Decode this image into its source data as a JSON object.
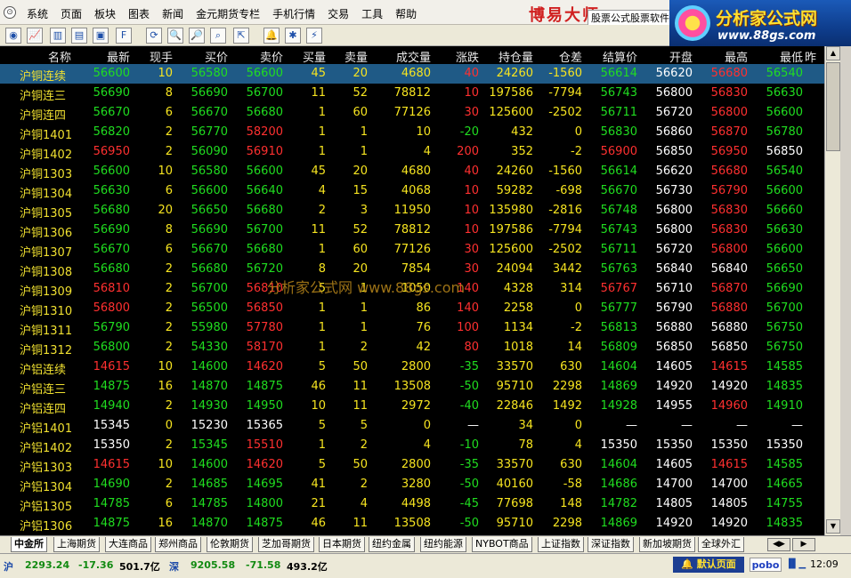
{
  "menubar": {
    "items": [
      "系统",
      "页面",
      "板块",
      "图表",
      "新闻",
      "金元期货专栏",
      "手机行情",
      "交易",
      "工具",
      "帮助"
    ],
    "brand_title": "博易大师",
    "soft_label": "股票公式股票软件"
  },
  "logo": {
    "name": "分析家公式网",
    "url": "www.88gs.com"
  },
  "toolbar": {
    "buttons": [
      {
        "icon": "circle-menu-icon",
        "glyph": "◉"
      },
      {
        "icon": "line-chart-icon",
        "glyph": "📈"
      },
      {
        "icon": "bar-chart-icon",
        "glyph": "▥"
      },
      {
        "icon": "table-icon",
        "glyph": "▤"
      },
      {
        "icon": "window-icon",
        "glyph": "▣"
      },
      {
        "icon": "f10-icon",
        "glyph": "F"
      },
      {
        "icon": "refresh-icon",
        "glyph": "⟳"
      },
      {
        "icon": "zoom-in-icon",
        "glyph": "🔍"
      },
      {
        "icon": "zoom-out-icon",
        "glyph": "🔎"
      },
      {
        "icon": "chart-search-icon",
        "glyph": "⌕"
      },
      {
        "icon": "export-icon",
        "glyph": "⇱"
      },
      {
        "icon": "alarm-icon",
        "glyph": "🔔"
      },
      {
        "icon": "settings-icon",
        "glyph": "✱"
      },
      {
        "icon": "lightning-icon",
        "glyph": "⚡"
      }
    ]
  },
  "grid": {
    "headers": [
      "名称",
      "最新",
      "现手",
      "买价",
      "卖价",
      "买量",
      "卖量",
      "成交量",
      "涨跌",
      "持仓量",
      "仓差",
      "结算价",
      "开盘",
      "最高",
      "最低",
      "昨"
    ],
    "watermark": "分析家公式网 www.88gs.com",
    "rows": [
      [
        "沪铜连续",
        "56600",
        "10",
        "56580",
        "56600",
        "45",
        "20",
        "4680",
        "40",
        "24260",
        "-1560",
        "56614",
        "56620",
        "56680",
        "56540"
      ],
      [
        "沪铜连三",
        "56690",
        "8",
        "56690",
        "56700",
        "11",
        "52",
        "78812",
        "10",
        "197586",
        "-7794",
        "56743",
        "56800",
        "56830",
        "56630"
      ],
      [
        "沪铜连四",
        "56670",
        "6",
        "56670",
        "56680",
        "1",
        "60",
        "77126",
        "30",
        "125600",
        "-2502",
        "56711",
        "56720",
        "56800",
        "56600"
      ],
      [
        "沪铜1401",
        "56820",
        "2",
        "56770",
        "58200",
        "1",
        "1",
        "10",
        "-20",
        "432",
        "0",
        "56830",
        "56860",
        "56870",
        "56780"
      ],
      [
        "沪铜1402",
        "56950",
        "2",
        "56090",
        "56910",
        "1",
        "1",
        "4",
        "200",
        "352",
        "-2",
        "56900",
        "56850",
        "56950",
        "56850"
      ],
      [
        "沪铜1303",
        "56600",
        "10",
        "56580",
        "56600",
        "45",
        "20",
        "4680",
        "40",
        "24260",
        "-1560",
        "56614",
        "56620",
        "56680",
        "56540"
      ],
      [
        "沪铜1304",
        "56630",
        "6",
        "56600",
        "56640",
        "4",
        "15",
        "4068",
        "10",
        "59282",
        "-698",
        "56670",
        "56730",
        "56790",
        "56600"
      ],
      [
        "沪铜1305",
        "56680",
        "20",
        "56650",
        "56680",
        "2",
        "3",
        "11950",
        "10",
        "135980",
        "-2816",
        "56748",
        "56800",
        "56830",
        "56660"
      ],
      [
        "沪铜1306",
        "56690",
        "8",
        "56690",
        "56700",
        "11",
        "52",
        "78812",
        "10",
        "197586",
        "-7794",
        "56743",
        "56800",
        "56830",
        "56630"
      ],
      [
        "沪铜1307",
        "56670",
        "6",
        "56670",
        "56680",
        "1",
        "60",
        "77126",
        "30",
        "125600",
        "-2502",
        "56711",
        "56720",
        "56800",
        "56600"
      ],
      [
        "沪铜1308",
        "56680",
        "2",
        "56680",
        "56720",
        "8",
        "20",
        "7854",
        "30",
        "24094",
        "3442",
        "56763",
        "56840",
        "56840",
        "56650"
      ],
      [
        "沪铜1309",
        "56810",
        "2",
        "56700",
        "56810",
        "5",
        "1",
        "1050",
        "140",
        "4328",
        "314",
        "56767",
        "56710",
        "56870",
        "56690"
      ],
      [
        "沪铜1310",
        "56800",
        "2",
        "56500",
        "56850",
        "1",
        "1",
        "86",
        "140",
        "2258",
        "0",
        "56777",
        "56790",
        "56880",
        "56700"
      ],
      [
        "沪铜1311",
        "56790",
        "2",
        "55980",
        "57780",
        "1",
        "1",
        "76",
        "100",
        "1134",
        "-2",
        "56813",
        "56880",
        "56880",
        "56750"
      ],
      [
        "沪铜1312",
        "56800",
        "2",
        "54330",
        "58170",
        "1",
        "2",
        "42",
        "80",
        "1018",
        "14",
        "56809",
        "56850",
        "56850",
        "56750"
      ],
      [
        "沪铝连续",
        "14615",
        "10",
        "14600",
        "14620",
        "5",
        "50",
        "2800",
        "-35",
        "33570",
        "630",
        "14604",
        "14605",
        "14615",
        "14585"
      ],
      [
        "沪铝连三",
        "14875",
        "16",
        "14870",
        "14875",
        "46",
        "11",
        "13508",
        "-50",
        "95710",
        "2298",
        "14869",
        "14920",
        "14920",
        "14835"
      ],
      [
        "沪铝连四",
        "14940",
        "2",
        "14930",
        "14950",
        "10",
        "11",
        "2972",
        "-40",
        "22846",
        "1492",
        "14928",
        "14955",
        "14960",
        "14910"
      ],
      [
        "沪铝1401",
        "15345",
        "0",
        "15230",
        "15365",
        "5",
        "5",
        "0",
        "—",
        "34",
        "0",
        "—",
        "—",
        "—",
        "—"
      ],
      [
        "沪铝1402",
        "15350",
        "2",
        "15345",
        "15510",
        "1",
        "2",
        "4",
        "-10",
        "78",
        "4",
        "15350",
        "15350",
        "15350",
        "15350"
      ],
      [
        "沪铝1303",
        "14615",
        "10",
        "14600",
        "14620",
        "5",
        "50",
        "2800",
        "-35",
        "33570",
        "630",
        "14604",
        "14605",
        "14615",
        "14585"
      ],
      [
        "沪铝1304",
        "14690",
        "2",
        "14685",
        "14695",
        "41",
        "2",
        "3280",
        "-50",
        "40160",
        "-58",
        "14686",
        "14700",
        "14700",
        "14665"
      ],
      [
        "沪铝1305",
        "14785",
        "6",
        "14785",
        "14800",
        "21",
        "4",
        "4498",
        "-45",
        "77698",
        "148",
        "14782",
        "14805",
        "14805",
        "14755"
      ],
      [
        "沪铝1306",
        "14875",
        "16",
        "14870",
        "14875",
        "46",
        "11",
        "13508",
        "-50",
        "95710",
        "2298",
        "14869",
        "14920",
        "14920",
        "14835"
      ]
    ]
  },
  "tabs": [
    "中金所",
    "上海期货",
    "大连商品",
    "郑州商品",
    "伦敦期货",
    "芝加哥期货",
    "日本期货",
    "纽约金属",
    "纽约能源",
    "NYBOT商品",
    "上证指数",
    "深证指数",
    "新加坡期货",
    "全球外汇"
  ],
  "status": {
    "sh_label": "沪",
    "sh_index": "2293.24",
    "sh_change": "-17.36",
    "sh_amount": "501.7亿",
    "sz_label": "深",
    "sz_index": "9205.58",
    "sz_change": "-71.58",
    "sz_amount": "493.2亿",
    "default_page_button": "默认页面",
    "brand": "pobo",
    "time": "12:09"
  },
  "colors": {
    "up": "#ff3030",
    "down": "#20dd20",
    "flat": "#f6e420",
    "name": "#f0e030",
    "selected_row": "#1f5a86"
  }
}
